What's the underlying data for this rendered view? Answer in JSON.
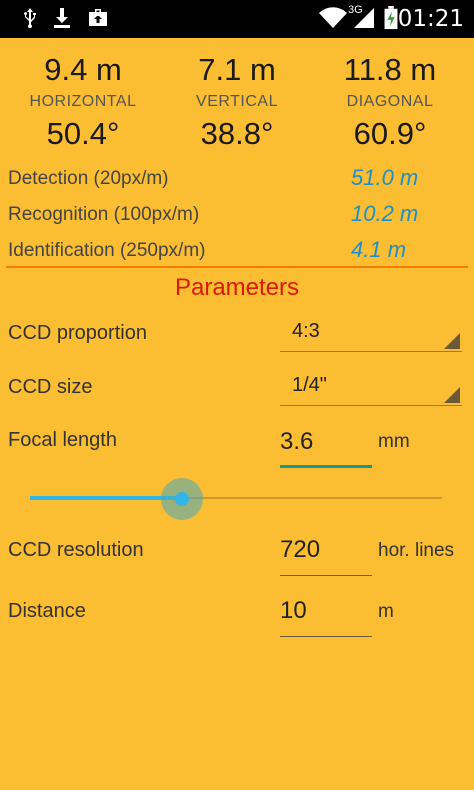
{
  "status_bar": {
    "time": "01:21",
    "icons": [
      "usb-icon",
      "download-icon",
      "briefcase-icon",
      "wifi-icon",
      "signal-3g-icon",
      "battery-charging-icon"
    ],
    "network_label": "3G"
  },
  "field_of_view": {
    "horizontal": {
      "distance": "9.4 m",
      "label": "HORIZONTAL",
      "angle": "50.4°"
    },
    "vertical": {
      "distance": "7.1 m",
      "label": "VERTICAL",
      "angle": "38.8°"
    },
    "diagonal": {
      "distance": "11.8 m",
      "label": "DIAGONAL",
      "angle": "60.9°"
    }
  },
  "pixel_density": {
    "detection": {
      "label": "Detection (20px/m)",
      "value": "51.0 m"
    },
    "recognition": {
      "label": "Recognition (100px/m)",
      "value": "10.2 m"
    },
    "identification": {
      "label": "Identification (250px/m)",
      "value": "4.1 m"
    }
  },
  "parameters": {
    "title": "Parameters",
    "ccd_proportion": {
      "label": "CCD proportion",
      "value": "4:3"
    },
    "ccd_size": {
      "label": "CCD size",
      "value": "1/4\""
    },
    "focal_length": {
      "label": "Focal length",
      "value": "3.6",
      "unit": "mm",
      "slider_fraction": 0.37
    },
    "ccd_resolution": {
      "label": "CCD resolution",
      "value": "720",
      "unit": "hor. lines"
    },
    "distance": {
      "label": "Distance",
      "value": "10",
      "unit": "m"
    }
  },
  "colors": {
    "background": "#FBBD32",
    "accent_blue": "#1E8FC8",
    "title_red": "#D81B00",
    "divider_orange": "#F57C00",
    "slider_blue": "#33B5E5",
    "focus_teal": "#1a9a8a"
  }
}
